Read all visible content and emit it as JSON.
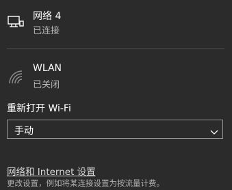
{
  "networks": [
    {
      "name": "网络 4",
      "status": "已连接",
      "icon": "ethernet-icon"
    },
    {
      "name": "WLAN",
      "status": "已关闭",
      "icon": "wifi-icon"
    }
  ],
  "reconnect": {
    "label": "重新打开 Wi-Fi",
    "selected_value": "手动"
  },
  "footer": {
    "link_label": "网络和 Internet 设置",
    "description": "更改设置，例如将某连接设置为按流量计费。"
  },
  "colors": {
    "background": "#2b2b2b",
    "text_primary": "#ffffff",
    "text_secondary": "#b8b8b8",
    "divider": "#505050"
  }
}
